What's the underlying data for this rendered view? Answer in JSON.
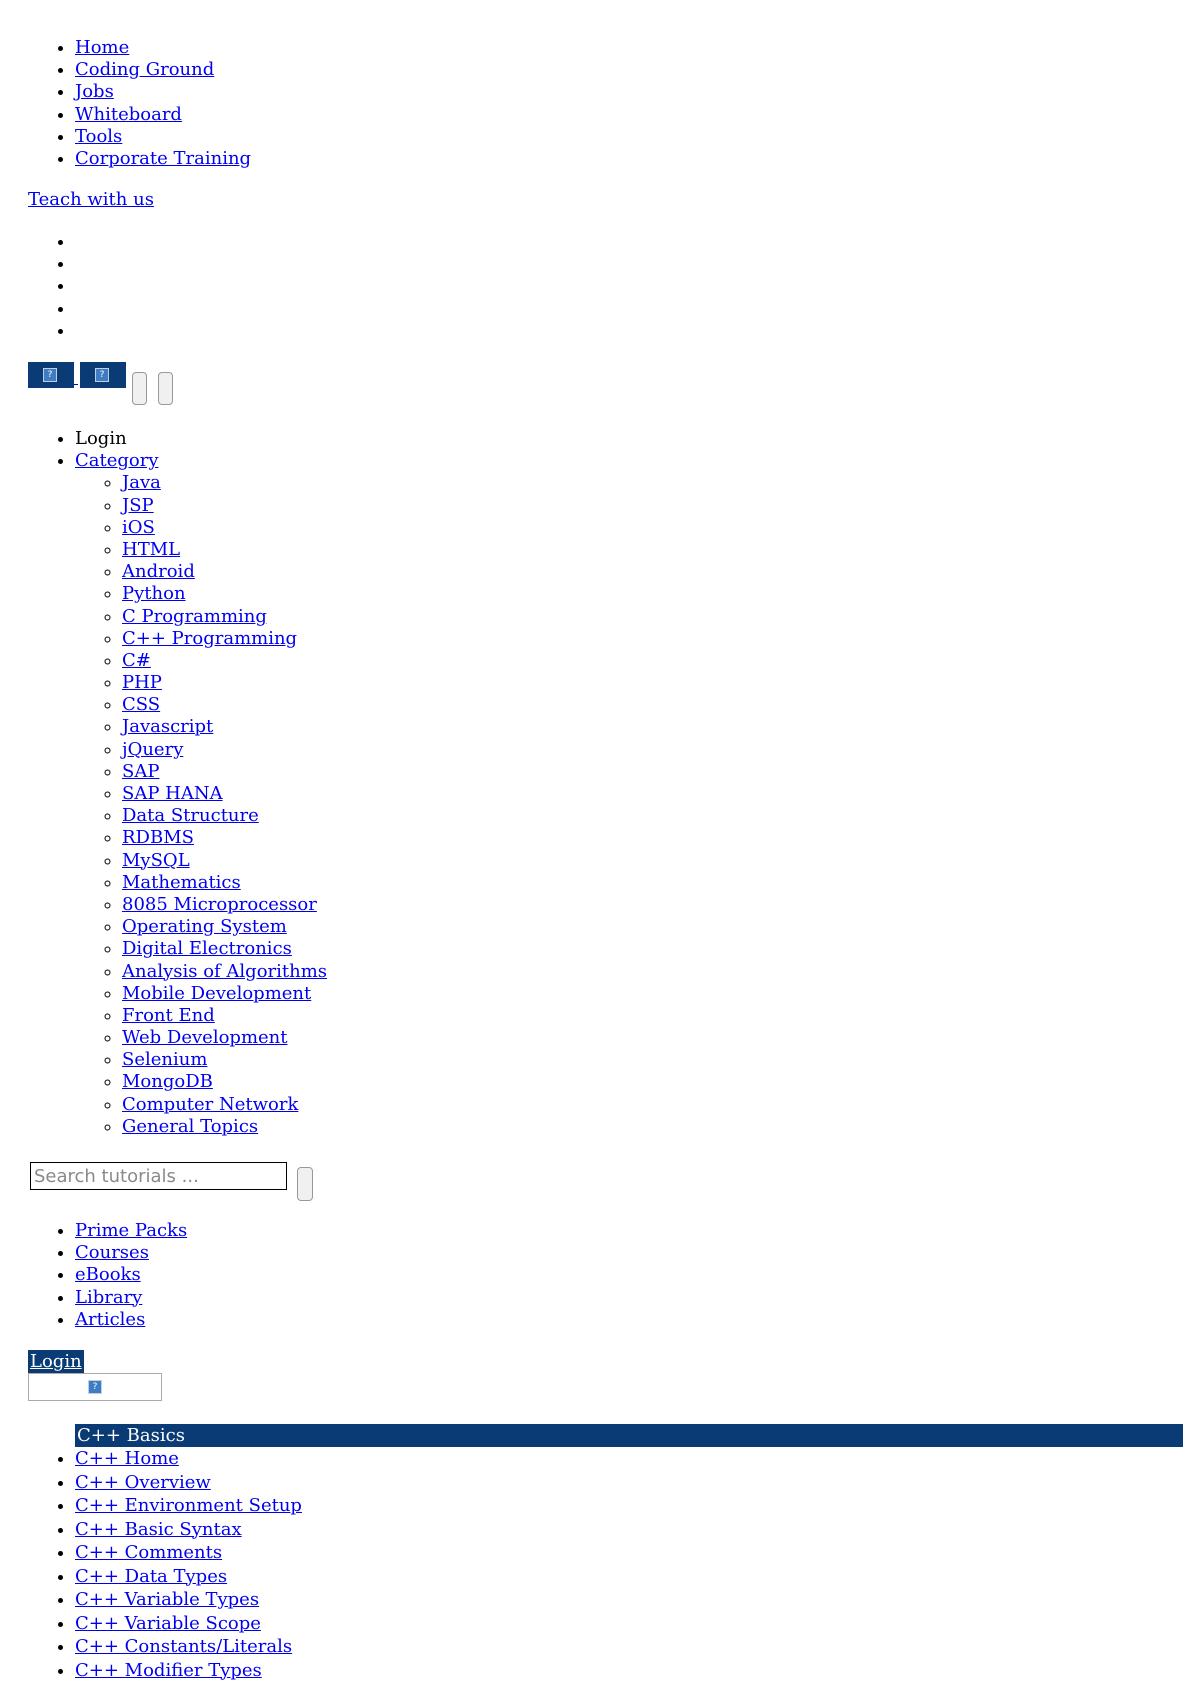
{
  "top_nav": [
    " Home",
    " Coding Ground",
    " Jobs",
    " Whiteboard",
    " Tools",
    " Corporate Training"
  ],
  "teach_link": "Teach with us",
  "login_label": "Login",
  "category_label": "Category",
  "categories": [
    " Java",
    " JSP",
    " iOS",
    " HTML",
    " Android",
    " Python",
    " C Programming",
    " C++ Programming",
    " C#",
    " PHP",
    " CSS",
    " Javascript",
    " jQuery",
    " SAP",
    " SAP HANA",
    " Data Structure",
    " RDBMS",
    " MySQL",
    " Mathematics",
    " 8085 Microprocessor",
    " Operating System",
    " Digital Electronics",
    " Analysis of Algorithms",
    " Mobile Development",
    " Front End",
    " Web Development",
    " Selenium",
    " MongoDB",
    " Computer Network",
    " General Topics"
  ],
  "search": {
    "placeholder": "Search tutorials ..."
  },
  "resources": [
    "Prime Packs",
    "Courses",
    "eBooks",
    "Library",
    " Articles"
  ],
  "login_button": "Login",
  "cpp": {
    "header": "C++ Basics",
    "items": [
      "C++ Home",
      "C++ Overview",
      "C++ Environment Setup",
      "C++ Basic Syntax",
      "C++ Comments",
      "C++ Data Types",
      "C++ Variable Types",
      "C++ Variable Scope",
      "C++ Constants/Literals",
      "C++ Modifier Types"
    ]
  },
  "colors": {
    "link": "#0000ee",
    "brand_dark": "#0a3b75"
  }
}
